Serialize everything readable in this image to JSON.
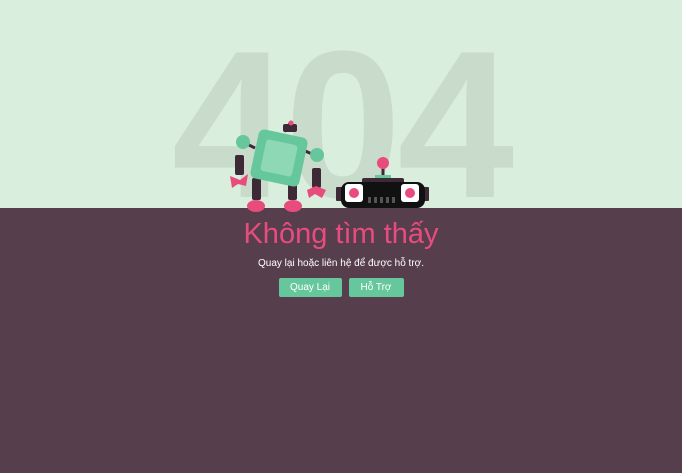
{
  "background_code": "404",
  "title": "Không tìm thấy",
  "subtitle": "Quay lại hoặc liên hệ để được hỗ trợ.",
  "buttons": {
    "back_label": "Quay Lại",
    "support_label": "Hỗ Trợ"
  },
  "colors": {
    "sky": "#d9eedd",
    "ground": "#563e4d",
    "accent_pink": "#e84c7d",
    "accent_green": "#66c79d"
  },
  "illustration": {
    "left": "robot-icon",
    "right": "broken-robot-head-icon"
  }
}
